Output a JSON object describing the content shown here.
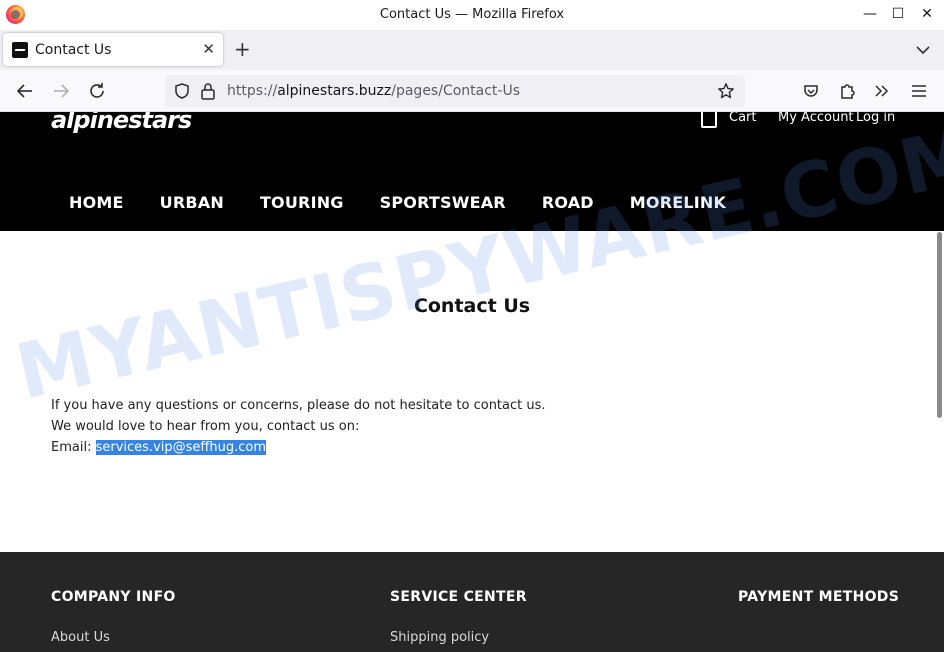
{
  "window": {
    "title": "Contact Us — Mozilla Firefox",
    "minimize_symbol": "—",
    "maximize_symbol": "☐",
    "close_symbol": "✕"
  },
  "tab": {
    "title": "Contact Us",
    "close_symbol": "✕",
    "new_tab_symbol": "+"
  },
  "urlbar": {
    "scheme": "https://",
    "host": "alpinestars.buzz",
    "path": "/pages/Contact-Us"
  },
  "site": {
    "brand": "alpinestars",
    "cart_label": "Cart",
    "account_label": "My Account",
    "login_label": "Log in",
    "nav": [
      "HOME",
      "URBAN",
      "TOURING",
      "SPORTSWEAR",
      "ROAD",
      "MORELINK"
    ]
  },
  "content": {
    "title": "Contact Us",
    "line1": "If you have any questions or concerns, please do not hesitate to contact us.",
    "line2": "We would love to hear from you, contact us on:",
    "email_label": "Email: ",
    "email": "services.vip@seffhug.com"
  },
  "footer": {
    "col1_title": "COMPANY INFO",
    "col1_link": "About Us",
    "col2_title": "SERVICE CENTER",
    "col2_link": "Shipping policy",
    "col3_title": "PAYMENT METHODS"
  },
  "watermark": "MYANTISPYWARE.COM",
  "colors": {
    "header_bg": "#000000",
    "footer_bg": "#262626",
    "selection": "#3584e4"
  }
}
